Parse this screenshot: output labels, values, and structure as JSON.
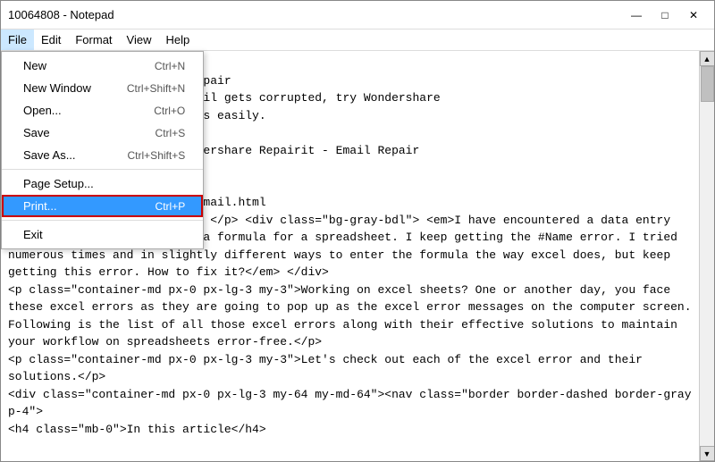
{
  "window": {
    "title": "10064808 - Notepad",
    "controls": {
      "minimize": "—",
      "maximize": "□",
      "close": "✕"
    }
  },
  "menubar": {
    "items": [
      {
        "label": "File",
        "active": true
      },
      {
        "label": "Edit"
      },
      {
        "label": "Format"
      },
      {
        "label": "View"
      },
      {
        "label": "Help"
      }
    ]
  },
  "file_menu": {
    "items": [
      {
        "label": "New",
        "shortcut": "Ctrl+N",
        "separator_after": false
      },
      {
        "label": "New Window",
        "shortcut": "Ctrl+Shift+N",
        "separator_after": false
      },
      {
        "label": "Open...",
        "shortcut": "Ctrl+O",
        "separator_after": false
      },
      {
        "label": "Save",
        "shortcut": "Ctrl+S",
        "separator_after": false
      },
      {
        "label": "Save As...",
        "shortcut": "Ctrl+Shift+S",
        "separator_after": true
      },
      {
        "label": "Page Setup...",
        "shortcut": "",
        "separator_after": false
      },
      {
        "label": "Print...",
        "shortcut": "Ctrl+P",
        "highlighted": true,
        "separator_after": true
      },
      {
        "label": "Exit",
        "shortcut": "",
        "separator_after": false
      }
    ]
  },
  "content": {
    "text": "</p>\n<strong></p><strong>email repair\n</strong></p>Whenever an email gets corrupted, try Wondershare\ns you repair corrupted emails easily.\n> </p> 10064808\n<ong></p>A Guide to Use Wondershare Repairit - Email Repair\n</strong></p>Excel repair\n>  </p> 10005682\n<ng></>/guide/repairit-for-email.html\n<p><strong>content:</strong> </p> <div class=\"bg-gray-bdl\"> <em>I have encountered a data entry problem when I try to enter a formula for a spreadsheet. I keep getting the #Name error. I tried numerous times and in slightly different ways to enter the formula the way excel does, but keep getting this error. How to fix it?</em> </div>\n<p class=\"container-md px-0 px-lg-3 my-3\">Working on excel sheets? One or another day, you face these excel errors as they are going to pop up as the excel error messages on the computer screen. Following is the list of all those excel errors along with their effective solutions to maintain your workflow on spreadsheets error-free.</p>\n<p class=\"container-md px-0 px-lg-3 my-3\">Let's check out each of the excel error and their solutions.</p>\n<div class=\"container-md px-0 px-lg-3 my-64 my-md-64\"><nav class=\"border border-dashed border-gray p-4\">\n<h4 class=\"mb-0\">In this article</h4>"
  }
}
